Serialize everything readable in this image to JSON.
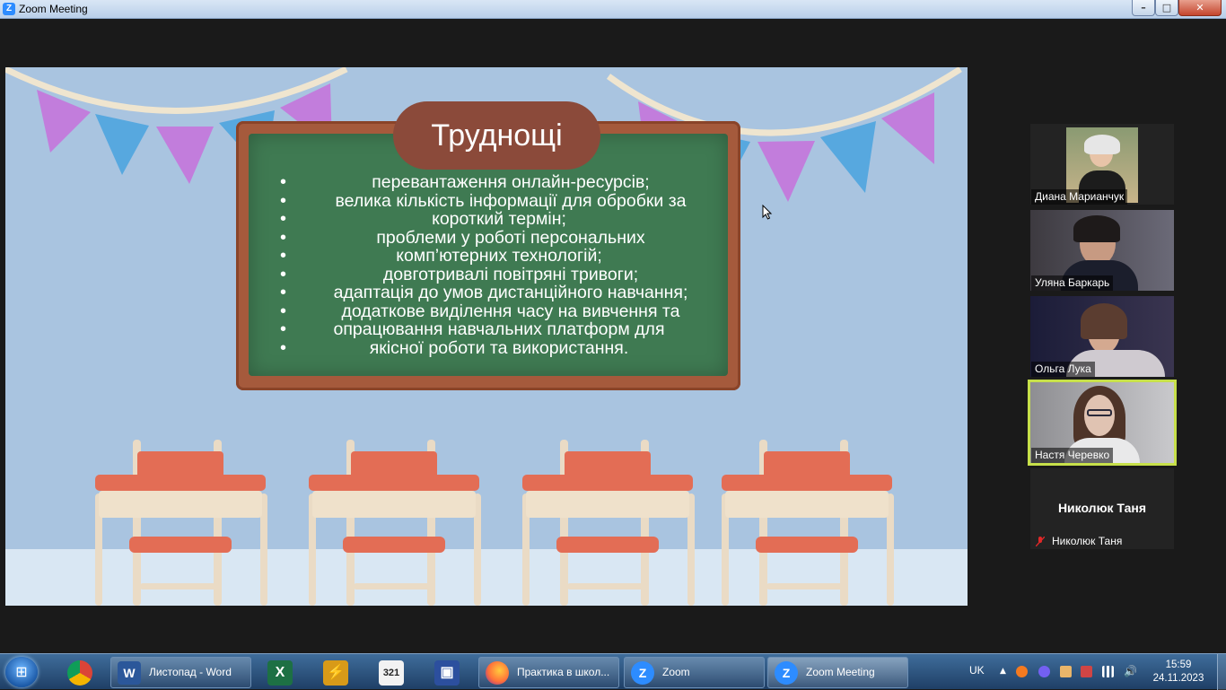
{
  "window": {
    "title": "Zoom Meeting"
  },
  "slide": {
    "title": "Труднощі",
    "lines": [
      "перевантаження онлайн-ресурсів;",
      "велика кількість інформації для обробки за",
      "короткий термін;",
      "проблеми у роботі персональних",
      "комп’ютерних технологій;",
      "довготривалі повітряні тривоги;",
      "адаптація до умов дистанційного навчання;",
      "додаткове виділення часу на вивчення та",
      "опрацювання навчальних платформ для",
      "якісної роботи та використання."
    ]
  },
  "participants": [
    {
      "name": "Диана Марианчук"
    },
    {
      "name": "Уляна Баркарь"
    },
    {
      "name": "Ольга Лука"
    },
    {
      "name": "Настя Черевко"
    },
    {
      "name": "Николюк Таня",
      "big_name": "Николюк Таня"
    }
  ],
  "taskbar": {
    "tasks": [
      {
        "label": "Листопад - Word",
        "icon": "W"
      },
      {
        "label": "Практика в школ...",
        "icon": "firefox"
      },
      {
        "label": "Zoom",
        "icon": "Z"
      },
      {
        "label": "Zoom Meeting",
        "icon": "Z"
      }
    ],
    "pinned": [
      {
        "name": "chrome-icon"
      },
      {
        "name": "excel-icon",
        "glyph": "X"
      },
      {
        "name": "winamp-icon",
        "glyph": "⚡"
      },
      {
        "name": "media-player-classic-icon",
        "glyph": "321"
      },
      {
        "name": "save-floppy-icon",
        "glyph": "▣"
      }
    ],
    "tray": {
      "language": "UK",
      "time": "15:59",
      "date": "24.11.2023"
    }
  },
  "colors": {
    "slide_bg": "#a9c4e0",
    "board_green": "#3f7a52",
    "board_frame": "#a55a3c",
    "title_pill": "#8b4a3a",
    "active_speaker": "#c7e04a",
    "zoom_blue": "#2d8cff"
  }
}
